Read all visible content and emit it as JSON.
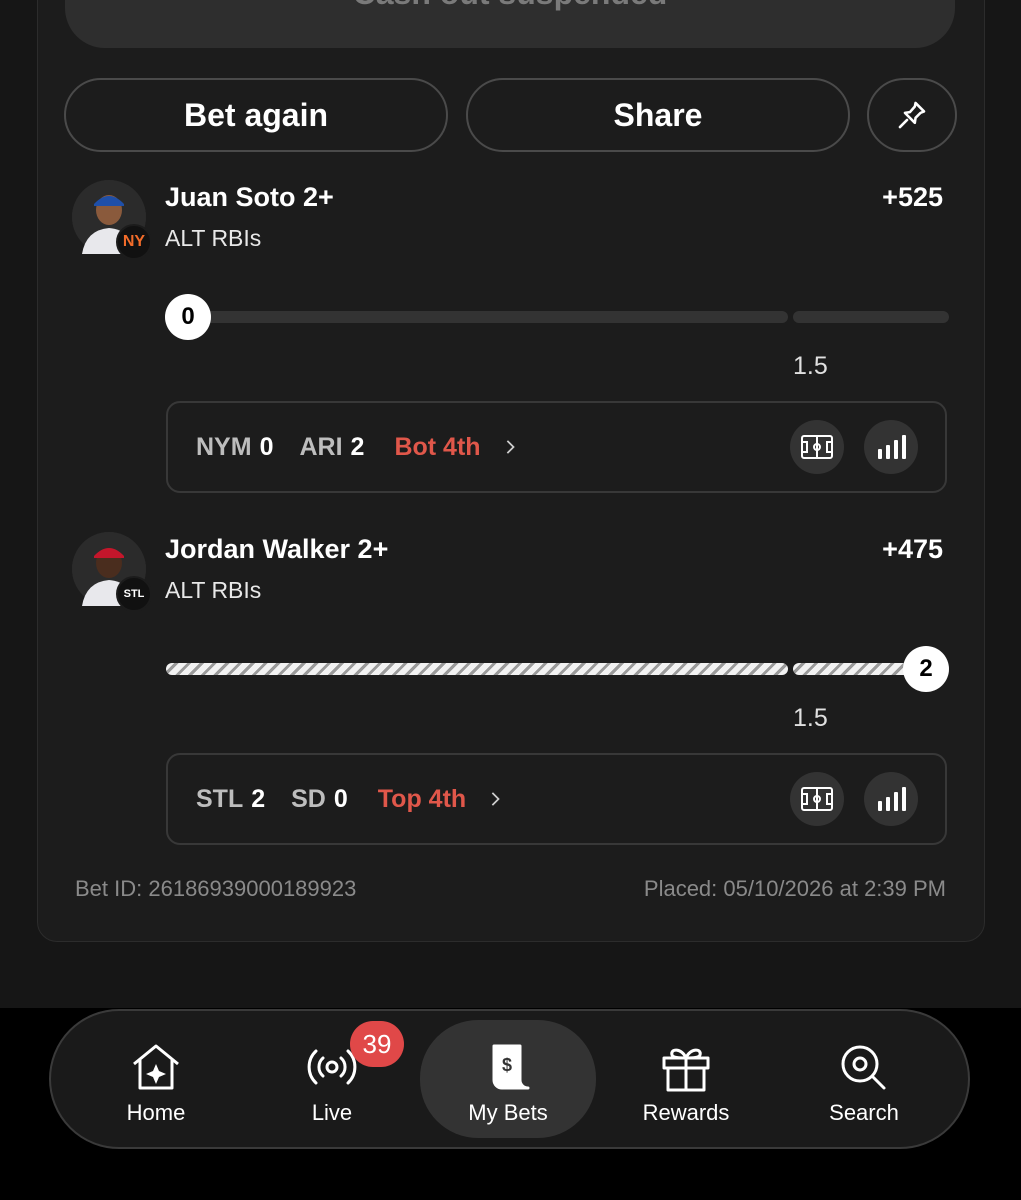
{
  "cashout": {
    "label": "Cash out suspended"
  },
  "actions": {
    "bet_again": "Bet again",
    "share": "Share",
    "pin_icon": "pin-icon"
  },
  "legs": [
    {
      "player": "Juan Soto 2+",
      "market": "ALT RBIs",
      "odds": "+525",
      "current": "0",
      "progress": 0.0,
      "line": "1.5",
      "team_logo": "NY",
      "game": {
        "away": "NYM",
        "away_score": "0",
        "home": "ARI",
        "home_score": "2",
        "inning": "Bot 4th"
      }
    },
    {
      "player": "Jordan Walker 2+",
      "market": "ALT RBIs",
      "odds": "+475",
      "current": "2",
      "progress": 1.0,
      "line": "1.5",
      "team_logo": "STL",
      "game": {
        "away": "STL",
        "away_score": "2",
        "home": "SD",
        "home_score": "0",
        "inning": "Top 4th"
      }
    }
  ],
  "footer": {
    "bet_id": "Bet ID: 26186939000189923",
    "placed": "Placed: 05/10/2026 at 2:39 PM"
  },
  "nav": {
    "items": [
      {
        "label": "Home",
        "icon": "home-icon"
      },
      {
        "label": "Live",
        "icon": "live-icon"
      },
      {
        "label": "My Bets",
        "icon": "my-bets-icon"
      },
      {
        "label": "Rewards",
        "icon": "rewards-icon"
      },
      {
        "label": "Search",
        "icon": "search-icon"
      }
    ],
    "live_badge": "39",
    "active": "My Bets"
  },
  "colors": {
    "accent_red": "#e0574a",
    "badge_red": "#e04848",
    "background": "#161616"
  }
}
